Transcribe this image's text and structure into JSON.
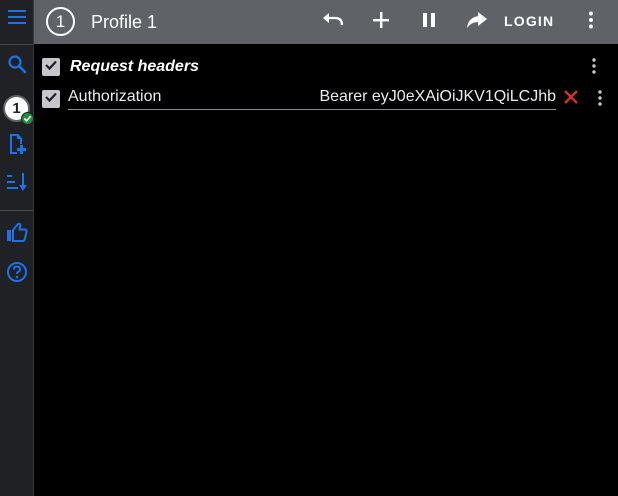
{
  "header": {
    "profile_number": "1",
    "title": "Profile 1",
    "login_label": "LOGIN"
  },
  "sidebar": {
    "active_profile_number": "1",
    "icons": [
      "menu-icon",
      "search-icon",
      "profile-badge",
      "add-file-icon",
      "sort-icon",
      "thumbs-up-icon",
      "help-icon"
    ]
  },
  "section": {
    "title": "Request headers",
    "enabled": true
  },
  "headers": [
    {
      "enabled": true,
      "name": "Authorization",
      "value": "Bearer eyJ0eXAiOiJKV1QiLCJhb"
    }
  ],
  "colors": {
    "header_bg": "#5f6368",
    "sidebar_bg": "#202124",
    "accent_blue": "#1a73e8",
    "delete_red": "#d93025",
    "check_green": "#1e8e3e"
  }
}
